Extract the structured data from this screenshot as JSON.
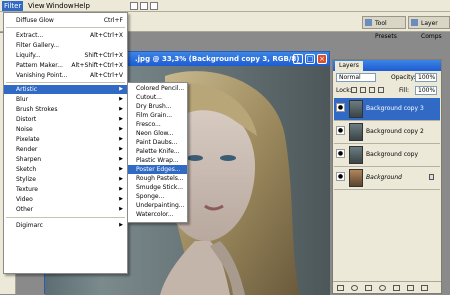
{
  "menubar": {
    "items": [
      {
        "label": "Filter",
        "active": true
      },
      {
        "label": "View",
        "active": false
      },
      {
        "label": "Window",
        "active": false
      },
      {
        "label": "Help",
        "active": false
      }
    ]
  },
  "optbar": {
    "tool_presets": "Tool Presets",
    "layer_comps": "Layer Comps"
  },
  "document": {
    "title": ".jpg @ 33,3% (Background copy 3, RGB/8)"
  },
  "filter_menu": {
    "items": [
      {
        "label": "Diffuse Glow",
        "shortcut": "Ctrl+F",
        "submenu": false
      },
      {
        "label": "Extract...",
        "shortcut": "Alt+Ctrl+X",
        "submenu": false
      },
      {
        "label": "Filter Gallery...",
        "shortcut": "",
        "submenu": false
      },
      {
        "label": "Liquify...",
        "shortcut": "Shift+Ctrl+X",
        "submenu": false
      },
      {
        "label": "Pattern Maker...",
        "shortcut": "Alt+Shift+Ctrl+X",
        "submenu": false
      },
      {
        "label": "Vanishing Point...",
        "shortcut": "Alt+Ctrl+V",
        "submenu": false
      },
      {
        "label": "Artistic",
        "shortcut": "",
        "submenu": true,
        "highlight": true
      },
      {
        "label": "Blur",
        "shortcut": "",
        "submenu": true
      },
      {
        "label": "Brush Strokes",
        "shortcut": "",
        "submenu": true
      },
      {
        "label": "Distort",
        "shortcut": "",
        "submenu": true
      },
      {
        "label": "Noise",
        "shortcut": "",
        "submenu": true
      },
      {
        "label": "Pixelate",
        "shortcut": "",
        "submenu": true
      },
      {
        "label": "Render",
        "shortcut": "",
        "submenu": true
      },
      {
        "label": "Sharpen",
        "shortcut": "",
        "submenu": true
      },
      {
        "label": "Sketch",
        "shortcut": "",
        "submenu": true
      },
      {
        "label": "Stylize",
        "shortcut": "",
        "submenu": true
      },
      {
        "label": "Texture",
        "shortcut": "",
        "submenu": true
      },
      {
        "label": "Video",
        "shortcut": "",
        "submenu": true
      },
      {
        "label": "Other",
        "shortcut": "",
        "submenu": true
      },
      {
        "label": "Digimarc",
        "shortcut": "",
        "submenu": true
      }
    ]
  },
  "artistic_submenu": {
    "items": [
      "Colored Pencil...",
      "Cutout...",
      "Dry Brush...",
      "Film Grain...",
      "Fresco...",
      "Neon Glow...",
      "Paint Daubs...",
      "Palette Knife...",
      "Plastic Wrap...",
      "Poster Edges...",
      "Rough Pastels...",
      "Smudge Stick...",
      "Sponge...",
      "Underpainting...",
      "Watercolor..."
    ],
    "highlighted": "Poster Edges..."
  },
  "layers_panel": {
    "tab": "Layers",
    "blend_mode": "Normal",
    "opacity_label": "Opacity:",
    "opacity_value": "100%",
    "lock_label": "Lock:",
    "fill_label": "Fill:",
    "fill_value": "100%",
    "layers": [
      {
        "name": "Background copy 3",
        "selected": true
      },
      {
        "name": "Background copy 2",
        "selected": false
      },
      {
        "name": "Background copy",
        "selected": false
      },
      {
        "name": "Background",
        "selected": false,
        "locked": true
      }
    ]
  },
  "colors": {
    "accent": "#316ac5",
    "titlebar": "#1e5bd3",
    "chrome": "#ece9d8"
  }
}
